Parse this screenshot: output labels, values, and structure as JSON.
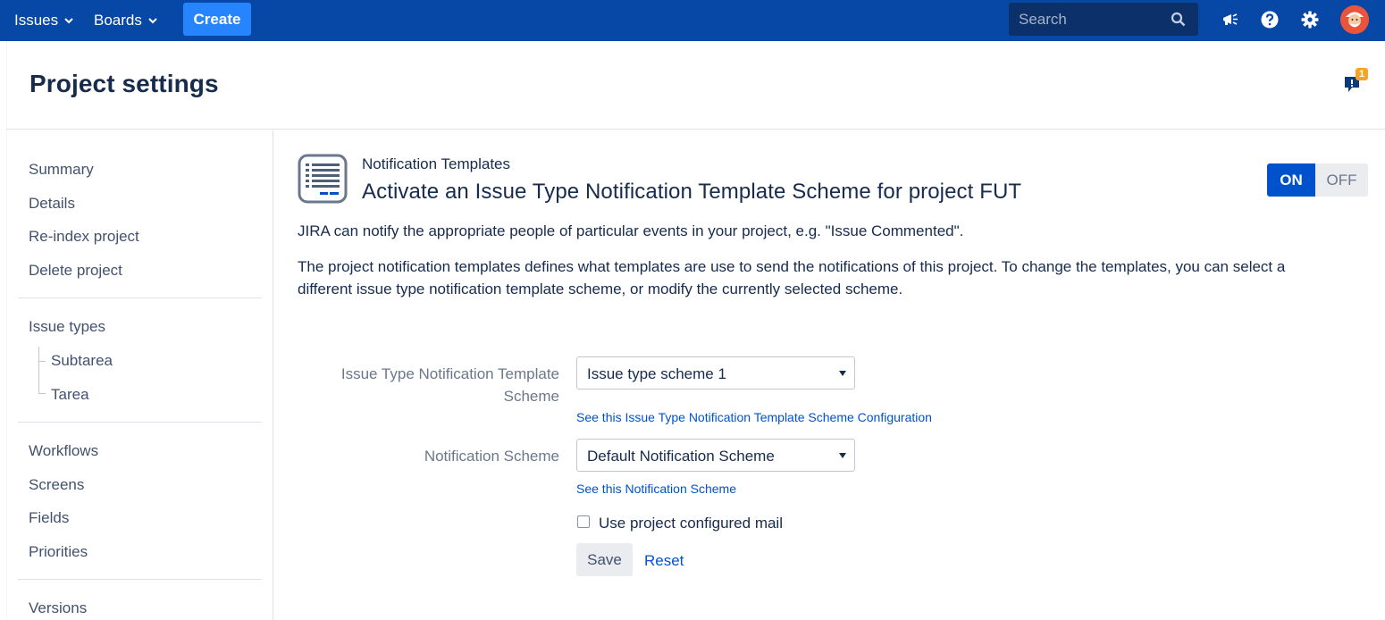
{
  "topbar": {
    "issues_label": "Issues",
    "boards_label": "Boards",
    "create_label": "Create",
    "search_placeholder": "Search"
  },
  "header": {
    "title": "Project settings",
    "feedback_count": "1"
  },
  "sidebar": {
    "group1": [
      "Summary",
      "Details",
      "Re-index project",
      "Delete project"
    ],
    "issue_types": "Issue types",
    "issue_subtypes": [
      "Subtarea",
      "Tarea"
    ],
    "group3": [
      "Workflows",
      "Screens",
      "Fields",
      "Priorities"
    ],
    "versions": "Versions"
  },
  "main": {
    "kicker": "Notification Templates",
    "heading": "Activate an Issue Type Notification Template Scheme for project FUT",
    "toggle_on": "ON",
    "toggle_off": "OFF",
    "desc1": "JIRA can notify the appropriate people of particular events in your project, e.g. \"Issue Commented\".",
    "desc2": "The project notification templates defines what templates are use to send the notifications of this project. To change the templates, you can select a different issue type notification template scheme, or modify the currently selected scheme.",
    "form": {
      "template_scheme_label_line1": "Issue Type Notification Template",
      "template_scheme_label_line2": "Scheme",
      "template_scheme_value": "Issue type scheme 1",
      "template_scheme_link": "See this Issue Type Notification Template Scheme Configuration",
      "notification_scheme_label": "Notification Scheme",
      "notification_scheme_value": "Default Notification Scheme",
      "notification_scheme_link": "See this Notification Scheme",
      "use_mail_label": "Use project configured mail",
      "save_label": "Save",
      "reset_label": "Reset"
    }
  }
}
